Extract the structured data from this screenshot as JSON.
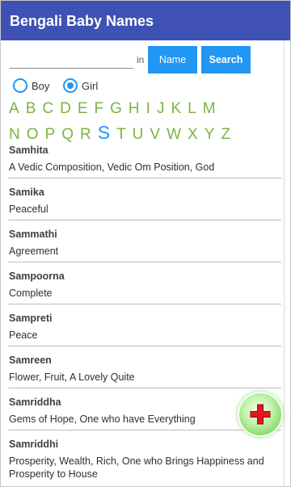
{
  "app": {
    "title": "Bengali Baby Names"
  },
  "search": {
    "value": "",
    "in_label": "in",
    "name_button": "Name",
    "search_button": "Search"
  },
  "gender": {
    "boy": {
      "label": "Boy",
      "selected": false
    },
    "girl": {
      "label": "Girl",
      "selected": true
    }
  },
  "alphabet": {
    "row1": [
      "A",
      "B",
      "C",
      "D",
      "E",
      "F",
      "G",
      "H",
      "I",
      "J",
      "K",
      "L",
      "M"
    ],
    "row2": [
      "N",
      "O",
      "P",
      "Q",
      "R",
      "S",
      "T",
      "U",
      "V",
      "W",
      "X",
      "Y",
      "Z"
    ],
    "selected": "S"
  },
  "names": [
    {
      "name": "Samhita",
      "meaning": "A Vedic Composition, Vedic Om Position, God"
    },
    {
      "name": "Samika",
      "meaning": "Peaceful"
    },
    {
      "name": "Sammathi",
      "meaning": "Agreement"
    },
    {
      "name": "Sampoorna",
      "meaning": "Complete"
    },
    {
      "name": "Sampreti",
      "meaning": "Peace"
    },
    {
      "name": "Samreen",
      "meaning": "Flower, Fruit, A Lovely Quite"
    },
    {
      "name": "Samriddha",
      "meaning": "Gems of Hope, One who have Everything"
    },
    {
      "name": "Samriddhi",
      "meaning": "Prosperity, Wealth, Rich, One who Brings Happiness and Prosperity to House"
    }
  ],
  "fab": {
    "icon": "plus-icon"
  },
  "colors": {
    "header": "#3F51B5",
    "button": "#2196F3",
    "accent": "#2196F3",
    "letter": "#7CB342",
    "letter-selected": "#2196F3",
    "fab-plus": "#E3161F"
  }
}
